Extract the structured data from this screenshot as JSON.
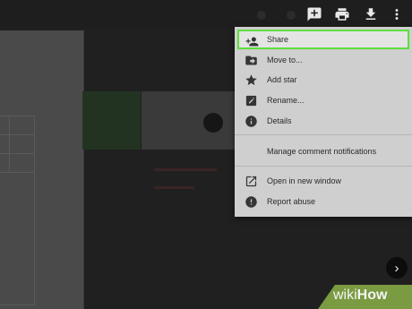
{
  "menu": {
    "items": [
      {
        "label": "Share",
        "icon": "add-person-icon",
        "highlighted": true
      },
      {
        "label": "Move to...",
        "icon": "move-folder-icon"
      },
      {
        "label": "Add star",
        "icon": "star-icon"
      },
      {
        "label": "Rename...",
        "icon": "pencil-icon"
      },
      {
        "label": "Details",
        "icon": "info-icon"
      }
    ],
    "notifications_label": "Manage comment notifications",
    "open_window_label": "Open in new window",
    "report_abuse_label": "Report abuse",
    "highlight_color": "#5dde3f"
  },
  "toolbar": {
    "icons": [
      "add-comment-icon",
      "print-icon",
      "download-icon",
      "more-vert-icon"
    ]
  },
  "watermark": {
    "prefix": "wiki",
    "suffix": "How",
    "color": "#7a9b41"
  }
}
